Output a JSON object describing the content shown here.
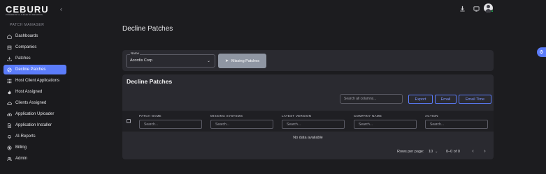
{
  "app": {
    "logo": "CEBURU",
    "logo_tagline": "POWERED BY AI, FUELED BY INNOVATION"
  },
  "sidebar": {
    "section_title": "PATCH MANAGER",
    "items": [
      {
        "label": "Dashboards",
        "icon": "home-icon"
      },
      {
        "label": "Companies",
        "icon": "building-icon"
      },
      {
        "label": "Patches",
        "icon": "download-icon"
      },
      {
        "label": "Decline Patches",
        "icon": "block-icon",
        "active": true
      },
      {
        "label": "Host Client Applications",
        "icon": "grid-icon"
      },
      {
        "label": "Host Assigned",
        "icon": "flame-icon"
      },
      {
        "label": "Clients Assigned",
        "icon": "cloud-icon"
      },
      {
        "label": "Application Uploader",
        "icon": "upload-cloud-icon"
      },
      {
        "label": "Application Installer",
        "icon": "file-icon"
      },
      {
        "label": "AI-Reports",
        "icon": "bell-icon"
      },
      {
        "label": "Billing",
        "icon": "dollar-icon"
      },
      {
        "label": "Admin",
        "icon": "users-icon"
      }
    ]
  },
  "header": {
    "page_title": "Decline Patches"
  },
  "filter": {
    "name_label": "Name",
    "name_value": "Acordis Corp",
    "missing_button": "Missing Patches"
  },
  "table_card": {
    "title": "Decline Patches",
    "search_placeholder": "Search all columns...",
    "buttons": {
      "export": "Export",
      "email": "Email",
      "email_time": "Email Time"
    },
    "columns": [
      {
        "header": "PATCH NAME",
        "placeholder": "Search..."
      },
      {
        "header": "MISSING SYSTEMS",
        "placeholder": "Search..."
      },
      {
        "header": "LATEST VERSION",
        "placeholder": "Search..."
      },
      {
        "header": "COMPANY NAME",
        "placeholder": "Search..."
      },
      {
        "header": "ACTION",
        "placeholder": "Search..."
      }
    ],
    "empty_text": "No data available",
    "pagination": {
      "rows_per_page_label": "Rows per page:",
      "rows_per_page_value": "10",
      "range": "0–0 of 0"
    }
  },
  "colors": {
    "accent": "#5b7cfa",
    "background": "#1c1c1f",
    "card": "#2a2a30",
    "status_online": "#22c55e"
  }
}
